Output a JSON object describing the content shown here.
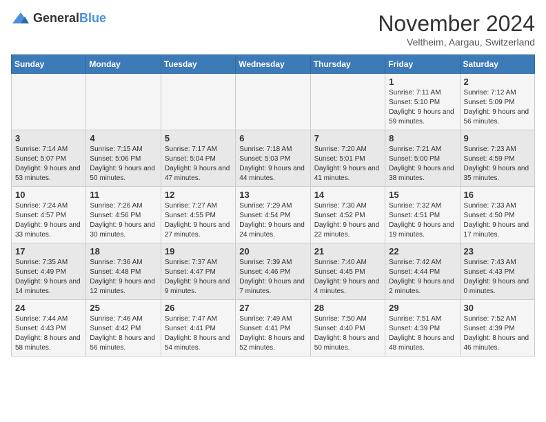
{
  "header": {
    "logo_general": "General",
    "logo_blue": "Blue",
    "month_title": "November 2024",
    "location": "Veltheim, Aargau, Switzerland"
  },
  "days_of_week": [
    "Sunday",
    "Monday",
    "Tuesday",
    "Wednesday",
    "Thursday",
    "Friday",
    "Saturday"
  ],
  "weeks": [
    [
      {
        "day": "",
        "info": ""
      },
      {
        "day": "",
        "info": ""
      },
      {
        "day": "",
        "info": ""
      },
      {
        "day": "",
        "info": ""
      },
      {
        "day": "",
        "info": ""
      },
      {
        "day": "1",
        "info": "Sunrise: 7:11 AM\nSunset: 5:10 PM\nDaylight: 9 hours and 59 minutes."
      },
      {
        "day": "2",
        "info": "Sunrise: 7:12 AM\nSunset: 5:09 PM\nDaylight: 9 hours and 56 minutes."
      }
    ],
    [
      {
        "day": "3",
        "info": "Sunrise: 7:14 AM\nSunset: 5:07 PM\nDaylight: 9 hours and 53 minutes."
      },
      {
        "day": "4",
        "info": "Sunrise: 7:15 AM\nSunset: 5:06 PM\nDaylight: 9 hours and 50 minutes."
      },
      {
        "day": "5",
        "info": "Sunrise: 7:17 AM\nSunset: 5:04 PM\nDaylight: 9 hours and 47 minutes."
      },
      {
        "day": "6",
        "info": "Sunrise: 7:18 AM\nSunset: 5:03 PM\nDaylight: 9 hours and 44 minutes."
      },
      {
        "day": "7",
        "info": "Sunrise: 7:20 AM\nSunset: 5:01 PM\nDaylight: 9 hours and 41 minutes."
      },
      {
        "day": "8",
        "info": "Sunrise: 7:21 AM\nSunset: 5:00 PM\nDaylight: 9 hours and 38 minutes."
      },
      {
        "day": "9",
        "info": "Sunrise: 7:23 AM\nSunset: 4:59 PM\nDaylight: 9 hours and 35 minutes."
      }
    ],
    [
      {
        "day": "10",
        "info": "Sunrise: 7:24 AM\nSunset: 4:57 PM\nDaylight: 9 hours and 33 minutes."
      },
      {
        "day": "11",
        "info": "Sunrise: 7:26 AM\nSunset: 4:56 PM\nDaylight: 9 hours and 30 minutes."
      },
      {
        "day": "12",
        "info": "Sunrise: 7:27 AM\nSunset: 4:55 PM\nDaylight: 9 hours and 27 minutes."
      },
      {
        "day": "13",
        "info": "Sunrise: 7:29 AM\nSunset: 4:54 PM\nDaylight: 9 hours and 24 minutes."
      },
      {
        "day": "14",
        "info": "Sunrise: 7:30 AM\nSunset: 4:52 PM\nDaylight: 9 hours and 22 minutes."
      },
      {
        "day": "15",
        "info": "Sunrise: 7:32 AM\nSunset: 4:51 PM\nDaylight: 9 hours and 19 minutes."
      },
      {
        "day": "16",
        "info": "Sunrise: 7:33 AM\nSunset: 4:50 PM\nDaylight: 9 hours and 17 minutes."
      }
    ],
    [
      {
        "day": "17",
        "info": "Sunrise: 7:35 AM\nSunset: 4:49 PM\nDaylight: 9 hours and 14 minutes."
      },
      {
        "day": "18",
        "info": "Sunrise: 7:36 AM\nSunset: 4:48 PM\nDaylight: 9 hours and 12 minutes."
      },
      {
        "day": "19",
        "info": "Sunrise: 7:37 AM\nSunset: 4:47 PM\nDaylight: 9 hours and 9 minutes."
      },
      {
        "day": "20",
        "info": "Sunrise: 7:39 AM\nSunset: 4:46 PM\nDaylight: 9 hours and 7 minutes."
      },
      {
        "day": "21",
        "info": "Sunrise: 7:40 AM\nSunset: 4:45 PM\nDaylight: 9 hours and 4 minutes."
      },
      {
        "day": "22",
        "info": "Sunrise: 7:42 AM\nSunset: 4:44 PM\nDaylight: 9 hours and 2 minutes."
      },
      {
        "day": "23",
        "info": "Sunrise: 7:43 AM\nSunset: 4:43 PM\nDaylight: 9 hours and 0 minutes."
      }
    ],
    [
      {
        "day": "24",
        "info": "Sunrise: 7:44 AM\nSunset: 4:43 PM\nDaylight: 8 hours and 58 minutes."
      },
      {
        "day": "25",
        "info": "Sunrise: 7:46 AM\nSunset: 4:42 PM\nDaylight: 8 hours and 56 minutes."
      },
      {
        "day": "26",
        "info": "Sunrise: 7:47 AM\nSunset: 4:41 PM\nDaylight: 8 hours and 54 minutes."
      },
      {
        "day": "27",
        "info": "Sunrise: 7:49 AM\nSunset: 4:41 PM\nDaylight: 8 hours and 52 minutes."
      },
      {
        "day": "28",
        "info": "Sunrise: 7:50 AM\nSunset: 4:40 PM\nDaylight: 8 hours and 50 minutes."
      },
      {
        "day": "29",
        "info": "Sunrise: 7:51 AM\nSunset: 4:39 PM\nDaylight: 8 hours and 48 minutes."
      },
      {
        "day": "30",
        "info": "Sunrise: 7:52 AM\nSunset: 4:39 PM\nDaylight: 8 hours and 46 minutes."
      }
    ]
  ]
}
